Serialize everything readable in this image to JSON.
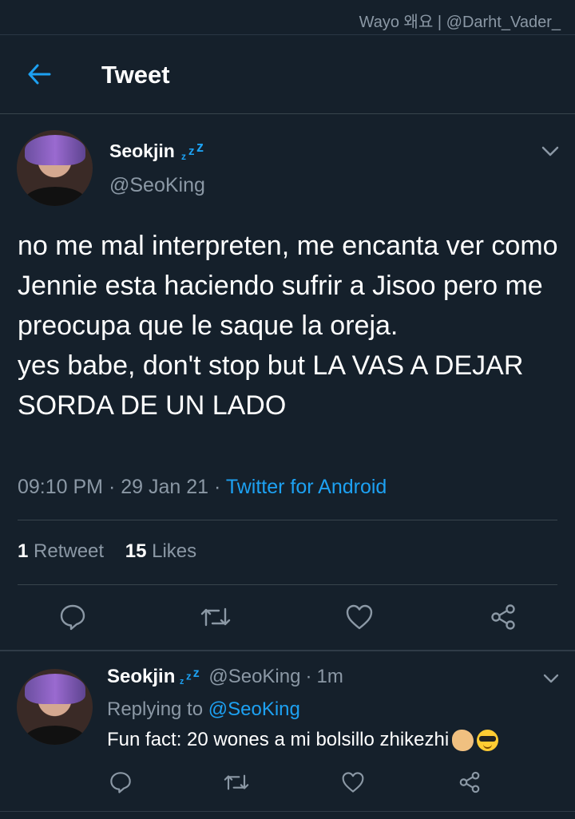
{
  "watermark": "Wayo 왜요 | @Darht_Vader_",
  "header": {
    "title": "Tweet"
  },
  "tweet": {
    "author_name": "Seokjin",
    "author_handle": "@SeoKing",
    "text": "no me mal interpreten, me encanta ver como Jennie esta haciendo sufrir a Jisoo pero me preocupa que le saque la oreja.\nyes babe, don't stop but LA VAS A DEJAR SORDA DE UN LADO",
    "time": "09:10 PM",
    "date": "29 Jan 21",
    "source": "Twitter for Android",
    "retweet_count": "1",
    "retweet_label": "Retweet",
    "likes_count": "15",
    "likes_label": "Likes"
  },
  "reply": {
    "author_name": "Seokjin",
    "author_handle": "@SeoKing",
    "age": "1m",
    "replying_prefix": "Replying to",
    "replying_to": "@SeoKing",
    "text": "Fun fact: 20 wones a mi bolsillo zhikezhi"
  },
  "icons": {
    "back": "arrow-left-icon",
    "more": "chevron-down-icon",
    "reply": "comment-icon",
    "retweet": "retweet-icon",
    "like": "heart-icon",
    "share": "share-icon",
    "sleep": "zzz-icon"
  },
  "colors": {
    "background": "#15202b",
    "accent": "#1da1f2",
    "secondary_text": "#8b98a5",
    "divider": "#38444d"
  }
}
